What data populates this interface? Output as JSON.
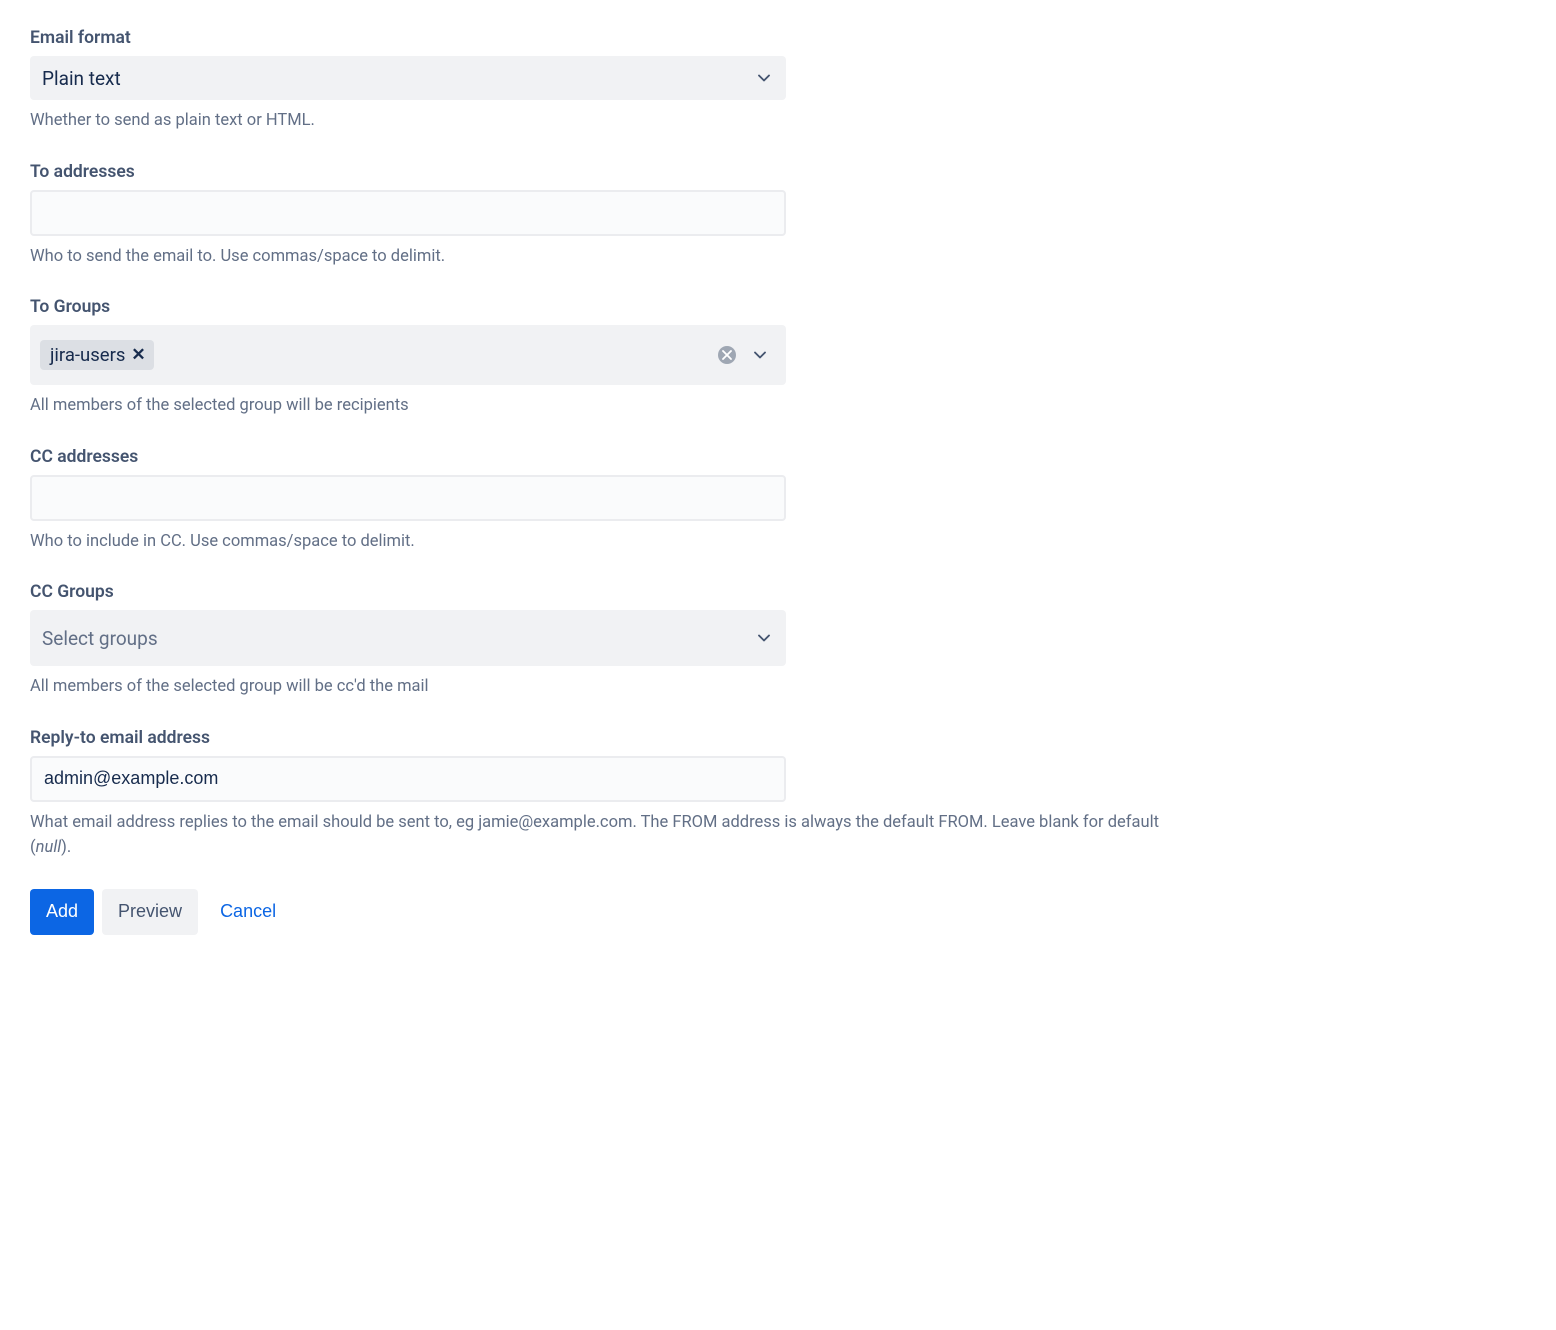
{
  "emailFormat": {
    "label": "Email format",
    "value": "Plain text",
    "help": "Whether to send as plain text or HTML."
  },
  "toAddresses": {
    "label": "To addresses",
    "value": "",
    "help": "Who to send the email to. Use commas/space to delimit."
  },
  "toGroups": {
    "label": "To Groups",
    "tags": [
      "jira-users"
    ],
    "help": "All members of the selected group will be recipients"
  },
  "ccAddresses": {
    "label": "CC addresses",
    "value": "",
    "help": "Who to include in CC. Use commas/space to delimit."
  },
  "ccGroups": {
    "label": "CC Groups",
    "placeholder": "Select groups",
    "help": "All members of the selected group will be cc'd the mail"
  },
  "replyTo": {
    "label": "Reply-to email address",
    "value": "admin@example.com",
    "helpPrefix": "What email address replies to the email should be sent to, eg jamie@example.com. The FROM address is always the default FROM. Leave blank for default (",
    "helpNull": "null",
    "helpSuffix": ")."
  },
  "actions": {
    "add": "Add",
    "preview": "Preview",
    "cancel": "Cancel"
  }
}
